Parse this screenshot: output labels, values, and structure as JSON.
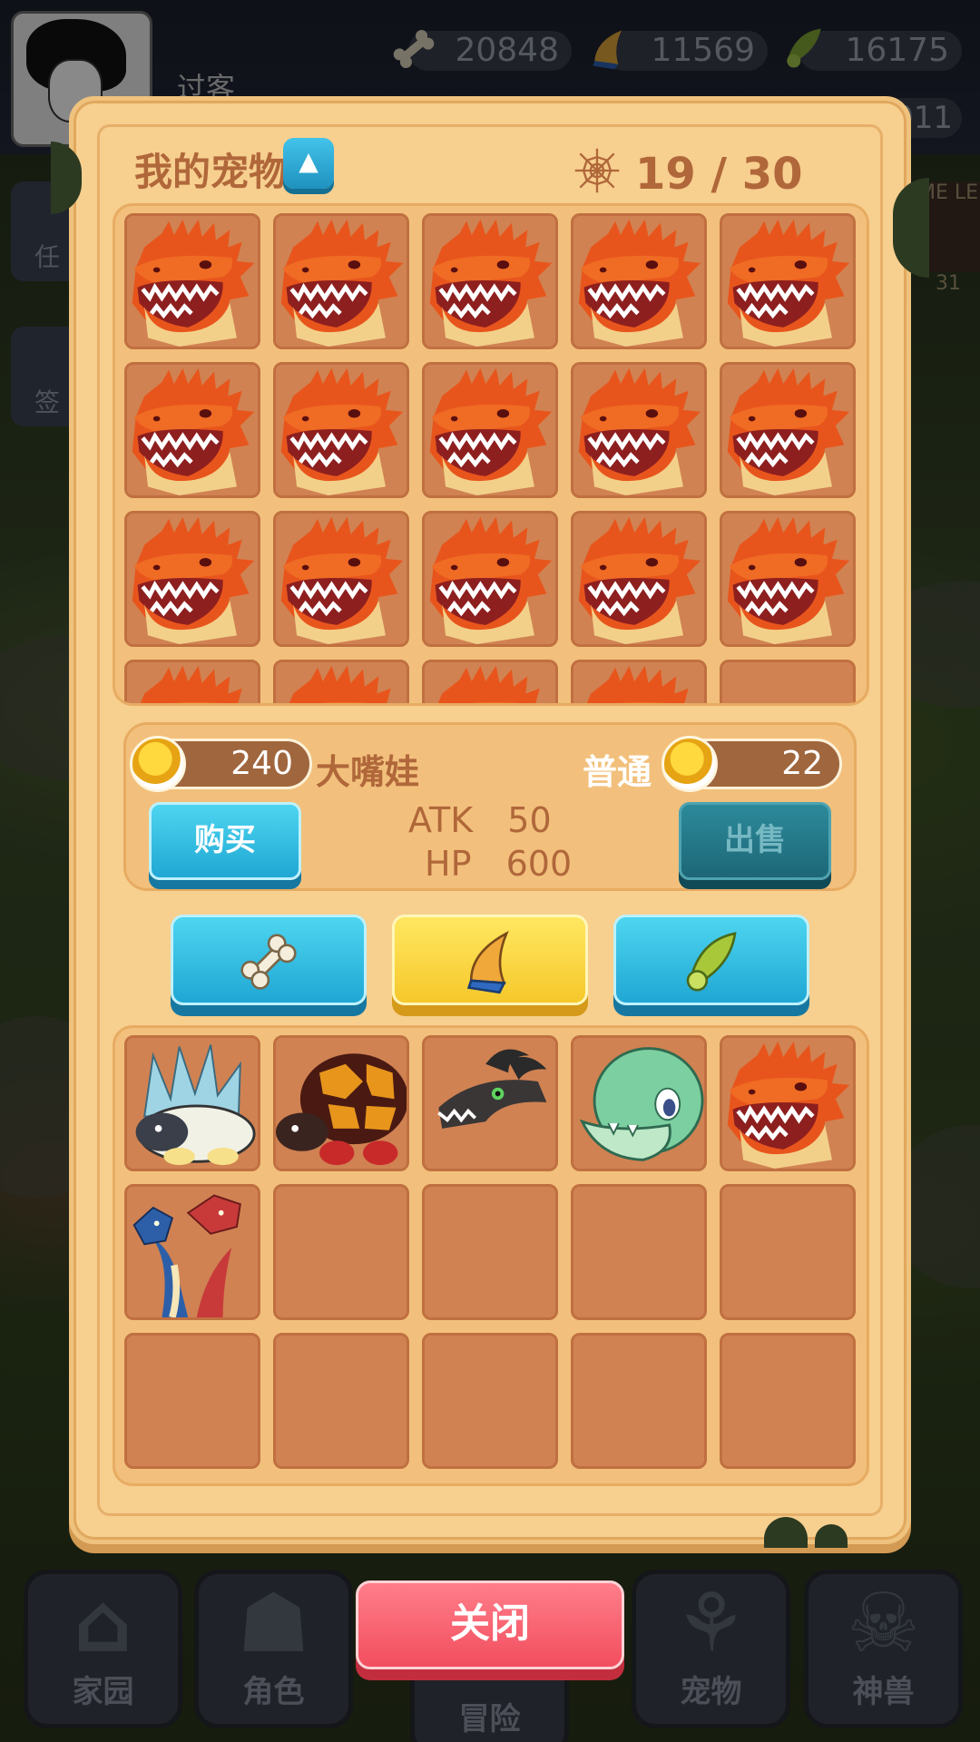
{
  "player": {
    "name": "过客"
  },
  "resources": [
    {
      "icon": "bone-icon",
      "value": "20848"
    },
    {
      "icon": "horn-icon",
      "value": "11569"
    },
    {
      "icon": "leaf-icon",
      "value": "16175"
    }
  ],
  "secondary_resource_value": "011",
  "left_menu": [
    {
      "label": "任"
    },
    {
      "label": "签"
    }
  ],
  "right_badges": [
    {
      "label": "ME LE"
    },
    {
      "label": "31"
    }
  ],
  "dialog": {
    "title": "我的宠物",
    "collapse_symbol": "▲",
    "pet_count": "19 / 30",
    "my_pets": [
      "fire-dragon",
      "fire-dragon",
      "fire-dragon",
      "fire-dragon",
      "fire-dragon",
      "fire-dragon",
      "fire-dragon",
      "fire-dragon",
      "fire-dragon",
      "fire-dragon",
      "fire-dragon",
      "fire-dragon",
      "fire-dragon",
      "fire-dragon",
      "fire-dragon",
      "fire-dragon",
      "fire-dragon",
      "fire-dragon",
      "fire-dragon",
      "empty"
    ],
    "selected_pet": {
      "buy_price": "240",
      "name": "大嘴娃",
      "rarity": "普通",
      "sell_price": "22",
      "atk_label": "ATK",
      "atk_value": "50",
      "hp_label": "HP",
      "hp_value": "600"
    },
    "buttons": {
      "buy": "购买",
      "sell": "出售"
    },
    "food_tabs": [
      {
        "icon": "bone-icon",
        "active": false
      },
      {
        "icon": "horn-icon",
        "active": true
      },
      {
        "icon": "leaf-icon",
        "active": false
      }
    ],
    "shop_pets": [
      "ice-spike-beast",
      "lava-turtle",
      "dark-horned-dragon",
      "green-dino",
      "fire-dragon",
      "two-headed-dragon",
      "empty",
      "empty",
      "empty",
      "empty",
      "empty",
      "empty",
      "empty",
      "empty",
      "empty"
    ],
    "close_label": "关闭"
  },
  "bottom_nav": [
    {
      "label": "家园",
      "icon": "home-icon"
    },
    {
      "label": "角色",
      "icon": "mask-icon"
    },
    {
      "label": "冒险",
      "icon": "adventure-icon"
    },
    {
      "label": "宠物",
      "icon": "pet-icon"
    },
    {
      "label": "神兽",
      "icon": "skull-icon"
    }
  ],
  "colors": {
    "panel": "#f7cf8f",
    "slot": "#d08252",
    "accent_text": "#b0673a",
    "blue_button": "#20a7d4",
    "red_button": "#f24e5e",
    "yellow_tab": "#f6c82b"
  }
}
